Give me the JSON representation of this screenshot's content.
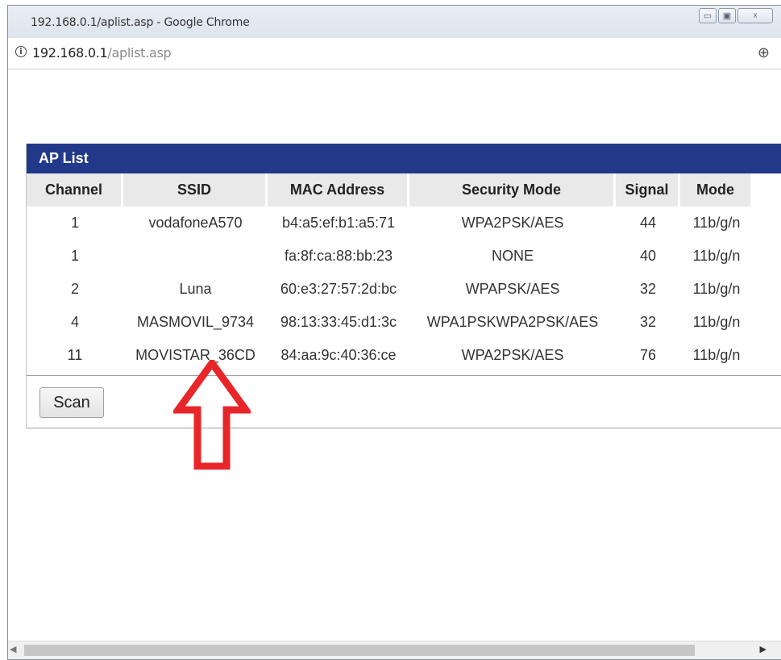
{
  "window": {
    "title": "192.168.0.1/aplist.asp - Google Chrome",
    "minimize_glyph": "▭",
    "maximize_glyph": "▣",
    "close_glyph": "☓"
  },
  "address": {
    "host": "192.168.0.1",
    "path": "/aplist.asp",
    "info_glyph": "i",
    "zoom_glyph": "⊕"
  },
  "aplist": {
    "title": "AP List",
    "columns": [
      "Channel",
      "SSID",
      "MAC Address",
      "Security Mode",
      "Signal",
      "Mode"
    ],
    "rows": [
      {
        "channel": "1",
        "ssid": "vodafoneA570",
        "mac": "b4:a5:ef:b1:a5:71",
        "security": "WPA2PSK/AES",
        "signal": "44",
        "mode": "11b/g/n"
      },
      {
        "channel": "1",
        "ssid": "",
        "mac": "fa:8f:ca:88:bb:23",
        "security": "NONE",
        "signal": "40",
        "mode": "11b/g/n"
      },
      {
        "channel": "2",
        "ssid": "Luna",
        "mac": "60:e3:27:57:2d:bc",
        "security": "WPAPSK/AES",
        "signal": "32",
        "mode": "11b/g/n"
      },
      {
        "channel": "4",
        "ssid": "MASMOVIL_9734",
        "mac": "98:13:33:45:d1:3c",
        "security": "WPA1PSKWPA2PSK/AES",
        "signal": "32",
        "mode": "11b/g/n"
      },
      {
        "channel": "11",
        "ssid": "MOVISTAR_36CD",
        "mac": "84:aa:9c:40:36:ce",
        "security": "WPA2PSK/AES",
        "signal": "76",
        "mode": "11b/g/n"
      }
    ],
    "scan_label": "Scan"
  },
  "annotation": {
    "arrow_color": "#e8262a"
  },
  "scrollbar": {
    "left_glyph": "◀",
    "right_glyph": "▶"
  }
}
